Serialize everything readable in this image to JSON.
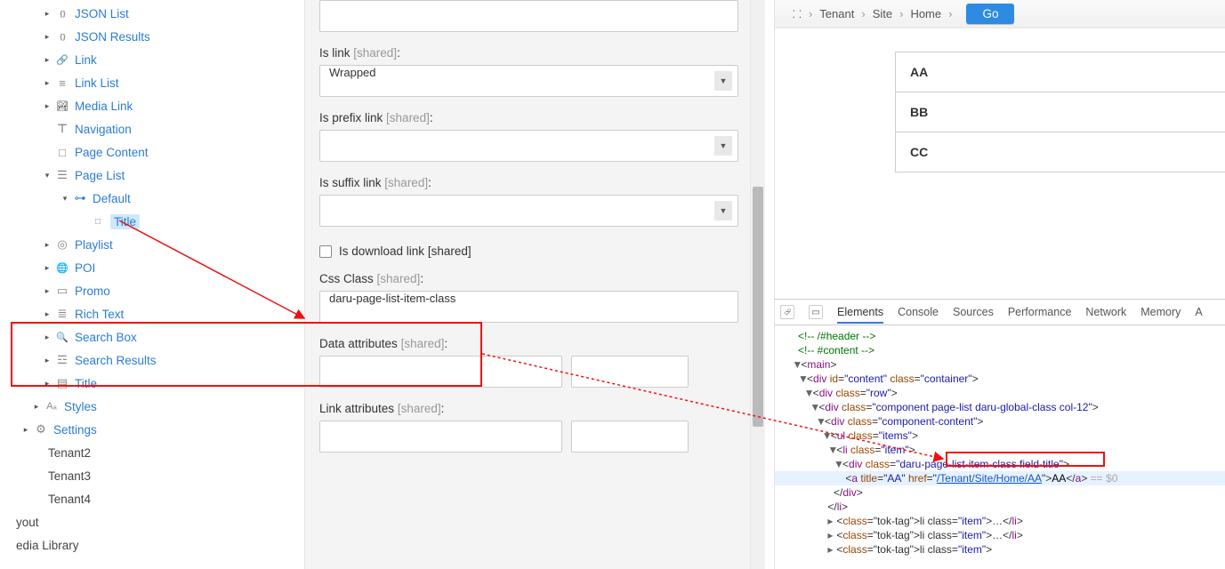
{
  "tree": {
    "items": [
      {
        "indent": 30,
        "caret": "right",
        "icon": "ic-json",
        "label": "JSON List",
        "link": true
      },
      {
        "indent": 30,
        "caret": "right",
        "icon": "ic-json",
        "label": "JSON Results",
        "link": true
      },
      {
        "indent": 30,
        "caret": "right",
        "icon": "ic-link",
        "label": "Link",
        "link": true
      },
      {
        "indent": 30,
        "caret": "right",
        "icon": "ic-list",
        "label": "Link List",
        "link": true
      },
      {
        "indent": 30,
        "caret": "right",
        "icon": "ic-media",
        "label": "Media Link",
        "link": true
      },
      {
        "indent": 30,
        "caret": "none",
        "icon": "ic-nav",
        "label": "Navigation",
        "link": true
      },
      {
        "indent": 30,
        "caret": "none",
        "icon": "ic-page",
        "label": "Page Content",
        "link": true
      },
      {
        "indent": 30,
        "caret": "down",
        "icon": "ic-pagelist",
        "label": "Page List",
        "link": true
      },
      {
        "indent": 50,
        "caret": "down",
        "icon": "ic-default",
        "label": "Default",
        "link": true
      },
      {
        "indent": 70,
        "caret": "none",
        "icon": "ic-title",
        "label": "Title",
        "link": true,
        "selected": true
      },
      {
        "indent": 30,
        "caret": "right",
        "icon": "ic-playlist",
        "label": "Playlist",
        "link": true
      },
      {
        "indent": 30,
        "caret": "right",
        "icon": "ic-poi",
        "label": "POI",
        "link": true
      },
      {
        "indent": 30,
        "caret": "right",
        "icon": "ic-promo",
        "label": "Promo",
        "link": true
      },
      {
        "indent": 30,
        "caret": "right",
        "icon": "ic-rich",
        "label": "Rich Text",
        "link": true
      },
      {
        "indent": 30,
        "caret": "right",
        "icon": "ic-search",
        "label": "Search Box",
        "link": true
      },
      {
        "indent": 30,
        "caret": "right",
        "icon": "ic-searchres",
        "label": "Search Results",
        "link": true
      },
      {
        "indent": 30,
        "caret": "right",
        "icon": "ic-titlemod",
        "label": "Title",
        "link": true
      },
      {
        "indent": 18,
        "caret": "right",
        "icon": "ic-styles",
        "label": "Styles",
        "link": true
      },
      {
        "indent": 6,
        "caret": "right",
        "icon": "ic-gear",
        "label": "Settings",
        "link": true
      },
      {
        "indent": 0,
        "caret": "none",
        "icon": "ic-folder",
        "label": "Tenant2",
        "muted": true
      },
      {
        "indent": 0,
        "caret": "none",
        "icon": "ic-folder",
        "label": "Tenant3",
        "muted": true
      },
      {
        "indent": 0,
        "caret": "none",
        "icon": "ic-folder",
        "label": "Tenant4",
        "muted": true
      },
      {
        "indent": -14,
        "caret": "none",
        "icon": "",
        "label": "yout",
        "muted": true
      },
      {
        "indent": -14,
        "caret": "none",
        "icon": "",
        "label": "edia Library",
        "muted": true
      }
    ]
  },
  "form": {
    "shared_suffix": "[shared]",
    "is_link_label": "Is link",
    "is_link_value": "Wrapped",
    "is_prefix_label": "Is prefix link",
    "is_suffix_label": "Is suffix link",
    "is_download_label": "Is download link",
    "css_class_label": "Css Class",
    "css_class_value": "daru-page-list-item-class",
    "data_attr_label": "Data attributes",
    "link_attr_label": "Link attributes"
  },
  "breadcrumb": {
    "tenant": "Tenant",
    "site": "Site",
    "home": "Home",
    "go": "Go"
  },
  "preview": {
    "items": [
      "AA",
      "BB",
      "CC"
    ]
  },
  "devtools": {
    "tabs": [
      "Elements",
      "Console",
      "Sources",
      "Performance",
      "Network",
      "Memory",
      "A"
    ],
    "active_tab": 0,
    "dom": {
      "c_header": "<!-- /#header -->",
      "c_content": "<!-- #content -->",
      "main_open": "main",
      "div_content": {
        "id": "content",
        "class": "container"
      },
      "div_row": {
        "class": "row"
      },
      "div_comp": {
        "class": "component page-list daru-global-class col-12"
      },
      "div_cc": {
        "class": "component-content"
      },
      "ul": {
        "class": "items"
      },
      "li": {
        "class": "item"
      },
      "div_item": {
        "class": "daru-page-list-item-class field-title"
      },
      "a": {
        "title": "AA",
        "href": "/Tenant/Site/Home/AA",
        "text": "AA"
      },
      "eq": "== $0",
      "li2": "<li class=\"item\">…</li>",
      "li3": "<li class=\"item\">…</li>",
      "li4": "<li class=\"item\">"
    }
  }
}
